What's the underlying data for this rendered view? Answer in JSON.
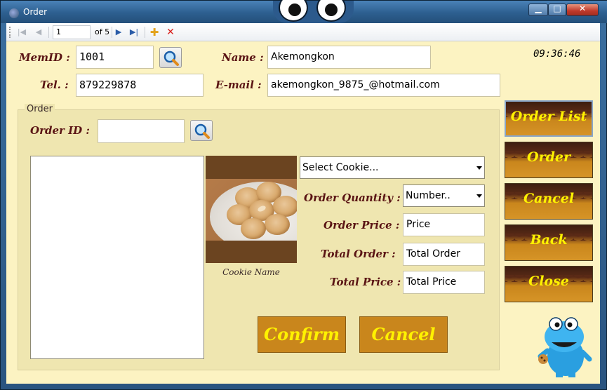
{
  "window": {
    "title": "Order",
    "minimize_label": "▁",
    "maximize_label": "□",
    "close_label": "✕"
  },
  "navigator": {
    "first_icon": "first-record-icon",
    "prev_icon": "prev-record-icon",
    "position": "1",
    "count_text": "of 5",
    "next_icon": "next-record-icon",
    "last_icon": "last-record-icon",
    "add_icon": "add-record-icon",
    "delete_icon": "delete-record-icon"
  },
  "member": {
    "memid_label": "MemID :",
    "memid_value": "1001",
    "name_label": "Name :",
    "name_value": "Akemongkon",
    "tel_label": "Tel. :",
    "tel_value": "879229878",
    "email_label": "E-mail :",
    "email_value": "akemongkon_9875_@hotmail.com"
  },
  "clock": "09:36:46",
  "order": {
    "group_title": "Order",
    "order_id_label": "Order ID :",
    "order_id_value": "",
    "cookie_select": "Select Cookie...",
    "quantity_label": "Order Quantity :",
    "quantity_select": "Number..",
    "price_label": "Order Price :",
    "price_value": "Price",
    "total_order_label": "Total Order  :",
    "total_order_value": "Total Order",
    "total_price_label": "Total Price :",
    "total_price_value": "Total Price",
    "cookie_name": "Cookie Name",
    "confirm_label": "Confirm",
    "cancel_label": "Cancel"
  },
  "side_menu": {
    "order_list": "Order List",
    "order": "Order",
    "cancel": "Cancel",
    "back": "Back",
    "close": "Close"
  },
  "colors": {
    "accent_text": "#fff200",
    "button_brown": "#c9861c",
    "label_maroon": "#5a1414",
    "background": "#fcf3c2"
  }
}
